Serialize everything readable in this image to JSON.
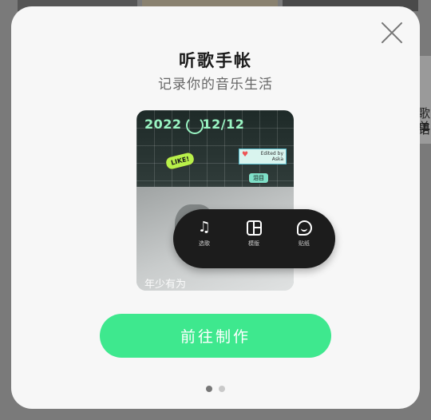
{
  "modal": {
    "title": "听歌手帐",
    "subtitle": "记录你的音乐生活",
    "cta_label": "前往制作",
    "pagination": {
      "total": 2,
      "active": 1
    }
  },
  "preview_card": {
    "date": "2022",
    "date_suffix": "12/12",
    "like_sticker": "LIKE!",
    "edited_by": "Edited by",
    "editor": "Aska",
    "tag": "泪目",
    "caption": "年少有为"
  },
  "toolbar": {
    "items": [
      {
        "label": "选歌",
        "icon": "music-note-icon"
      },
      {
        "label": "模版",
        "icon": "template-icon"
      },
      {
        "label": "贴纸",
        "icon": "sticker-icon"
      }
    ]
  },
  "background": {
    "right_text": [
      "歌单",
      "语"
    ]
  },
  "colors": {
    "accent": "#3ee88e",
    "toolbar_bg": "#1c1c1c",
    "dot_active": "#777777",
    "dot_inactive": "#c9c9c9"
  }
}
